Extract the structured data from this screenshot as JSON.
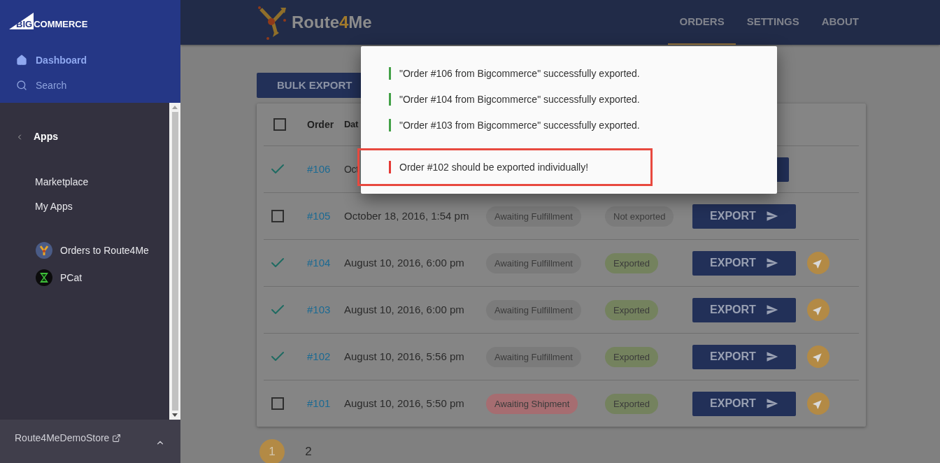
{
  "sidebar": {
    "logo": {
      "mark": "BIG",
      "word": "COMMERCE"
    },
    "nav": [
      {
        "label": "Dashboard",
        "kind": "home",
        "selected": true
      },
      {
        "label": "Search",
        "kind": "search",
        "selected": false
      }
    ],
    "section": {
      "title": "Apps"
    },
    "links": [
      {
        "label": "Marketplace"
      },
      {
        "label": "My Apps"
      }
    ],
    "apps": [
      {
        "label": "Orders to Route4Me",
        "kind": "route"
      },
      {
        "label": "PCat",
        "kind": "pcat"
      }
    ],
    "footer": {
      "store": "Route4MeDemoStore"
    }
  },
  "header": {
    "logo": {
      "first": "Route",
      "middle": "4",
      "last": "Me"
    },
    "tabs": [
      {
        "label": "ORDERS",
        "selected": true
      },
      {
        "label": "SETTINGS",
        "selected": false
      },
      {
        "label": "ABOUT",
        "selected": false
      }
    ]
  },
  "bulk_export": "BULK EXPORT",
  "table": {
    "header_checked": false,
    "columns": [
      "Order",
      "Dat"
    ],
    "rows": [
      {
        "kind": "covered",
        "checked": true,
        "order": "#106",
        "date": "Oct"
      },
      {
        "kind": "full",
        "checked": false,
        "order": "#105",
        "date": "October 18, 2016, 1:54 pm",
        "status": {
          "label": "Awaiting Fulfillment",
          "color": "#7b7b7b"
        },
        "export_status": {
          "label": "Not exported",
          "color": "#7b7b7b"
        },
        "button": "EXPORT",
        "route": false
      },
      {
        "kind": "full",
        "checked": true,
        "order": "#104",
        "date": "August 10, 2016, 6:00 pm",
        "status": {
          "label": "Awaiting Fulfillment",
          "color": "#7b7b7b"
        },
        "export_status": {
          "label": "Exported",
          "color": "#74825e"
        },
        "button": "EXPORT",
        "route": true
      },
      {
        "kind": "full",
        "checked": true,
        "order": "#103",
        "date": "August 10, 2016, 6:00 pm",
        "status": {
          "label": "Awaiting Fulfillment",
          "color": "#7b7b7b"
        },
        "export_status": {
          "label": "Exported",
          "color": "#74825e"
        },
        "button": "EXPORT",
        "route": true
      },
      {
        "kind": "full",
        "checked": true,
        "order": "#102",
        "date": "August 10, 2016, 5:56 pm",
        "status": {
          "label": "Awaiting Fulfillment",
          "color": "#7b7b7b"
        },
        "export_status": {
          "label": "Exported",
          "color": "#74825e"
        },
        "button": "EXPORT",
        "route": true
      },
      {
        "kind": "full",
        "checked": false,
        "order": "#101",
        "date": "August 10, 2016, 5:50 pm",
        "status": {
          "label": "Awaiting Shipment",
          "color": "#a66d71"
        },
        "export_status": {
          "label": "Exported",
          "color": "#74825e"
        },
        "button": "EXPORT",
        "route": true
      }
    ]
  },
  "pagination": [
    {
      "label": "1",
      "selected": true
    },
    {
      "label": "2",
      "selected": false
    }
  ],
  "notifications": [
    {
      "kind": "success",
      "text": "\"Order #106 from Bigcommerce\" successfully exported.",
      "highlighted": false
    },
    {
      "kind": "success",
      "text": "\"Order #104 from Bigcommerce\" successfully exported.",
      "highlighted": false
    },
    {
      "kind": "success",
      "text": "\"Order #103 from Bigcommerce\" successfully exported.",
      "highlighted": false
    },
    {
      "kind": "error",
      "text": "Order #102 should be exported individually!",
      "highlighted": true
    }
  ]
}
